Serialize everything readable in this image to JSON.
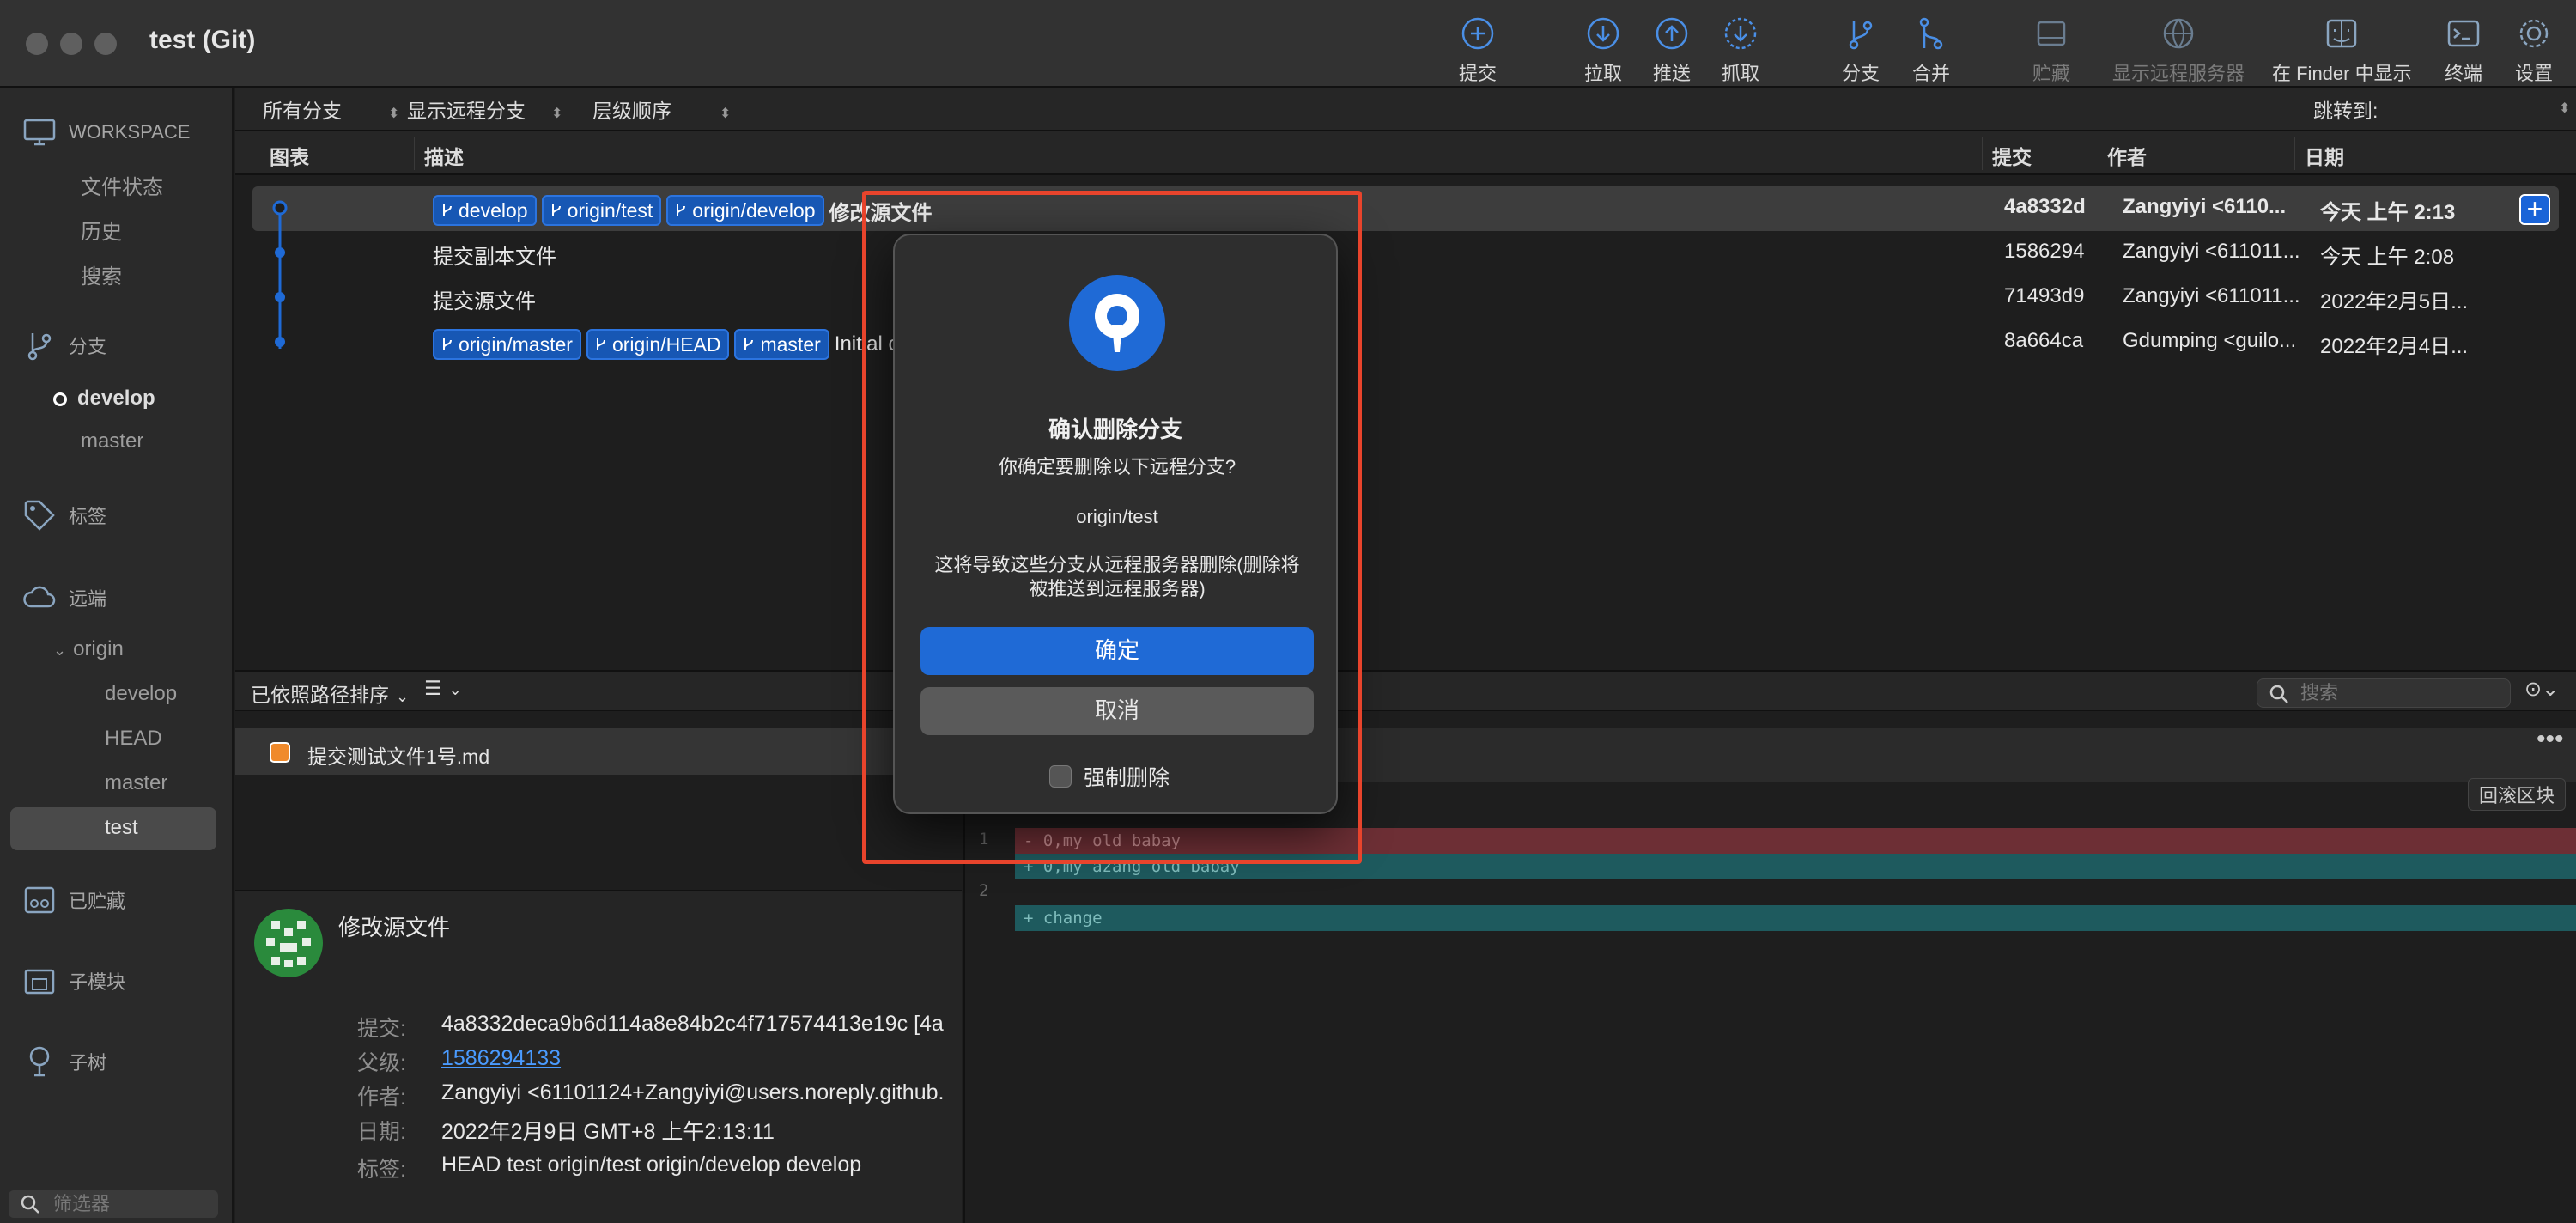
{
  "window": {
    "title": "test (Git)"
  },
  "toolbar": {
    "commit": "提交",
    "pull": "拉取",
    "push": "推送",
    "fetch": "抓取",
    "branch": "分支",
    "merge": "合并",
    "stash": "贮藏",
    "show_remote": "显示远程服务器",
    "finder": "在 Finder 中显示",
    "terminal": "终端",
    "settings": "设置"
  },
  "sidebar": {
    "workspace": "WORKSPACE",
    "file_status": "文件状态",
    "history": "历史",
    "search": "搜索",
    "branches": "分支",
    "branch_develop": "develop",
    "branch_master": "master",
    "tags": "标签",
    "remotes": "远端",
    "origin": "origin",
    "remote_develop": "develop",
    "remote_head": "HEAD",
    "remote_master": "master",
    "remote_test": "test",
    "stashes": "已贮藏",
    "submodules": "子模块",
    "subtrees": "子树",
    "filter_placeholder": "筛选器"
  },
  "filters": {
    "branches": "所有分支",
    "remote": "显示远程分支",
    "order": "层级顺序",
    "jump": "跳转到:"
  },
  "columns": {
    "graph": "图表",
    "description": "描述",
    "commit": "提交",
    "author": "作者",
    "date": "日期"
  },
  "commits": [
    {
      "tags": [
        "develop",
        "origin/test",
        "origin/develop"
      ],
      "message": "修改源文件",
      "hash": "4a8332d",
      "author": "Zangyiyi <6110...",
      "date": "今天 上午 2:13"
    },
    {
      "tags": [],
      "message": "提交副本文件",
      "hash": "1586294",
      "author": "Zangyiyi <611011...",
      "date": "今天 上午 2:08"
    },
    {
      "tags": [],
      "message": "提交源文件",
      "hash": "71493d9",
      "author": "Zangyiyi <611011...",
      "date": "2022年2月5日..."
    },
    {
      "tags": [
        "origin/master",
        "origin/HEAD",
        "master"
      ],
      "message": "Initial commit",
      "hash": "8a664ca",
      "author": "Gdumping <guilo...",
      "date": "2022年2月4日..."
    }
  ],
  "lower": {
    "sort": "已依照路径排序",
    "search_placeholder": "搜索",
    "file": "提交测试文件1号.md",
    "revert_hunk": "回滚区块"
  },
  "diff": [
    {
      "line": "1",
      "type": "del",
      "text": "- 0,my old babay"
    },
    {
      "line": "",
      "type": "add",
      "text": "+ 0,my azang old babay"
    },
    {
      "line": "2",
      "type": "blank",
      "text": ""
    },
    {
      "line": "",
      "type": "add",
      "text": "+ change"
    }
  ],
  "commit_info": {
    "message": "修改源文件",
    "commit_label": "提交:",
    "commit_value": "4a8332deca9b6d114a8e84b2c4f717574413e19c [4a",
    "parent_label": "父级:",
    "parent_value": "1586294133",
    "author_label": "作者:",
    "author_value": "Zangyiyi <61101124+Zangyiyi@users.noreply.github.",
    "date_label": "日期:",
    "date_value": "2022年2月9日 GMT+8 上午2:13:11",
    "tags_label": "标签:",
    "tags_value": "HEAD test origin/test origin/develop develop"
  },
  "dialog": {
    "title": "确认删除分支",
    "question": "你确定要删除以下远程分支?",
    "branch": "origin/test",
    "warning": "这将导致这些分支从远程服务器删除(删除将被推送到远程服务器)",
    "ok": "确定",
    "cancel": "取消",
    "force": "强制删除"
  },
  "colors": {
    "accent": "#1f6ad6",
    "tag_bg": "#1757b4",
    "highlight": "#e8442c",
    "diff_del": "#6d2f35",
    "diff_add": "#1e5a5e"
  }
}
